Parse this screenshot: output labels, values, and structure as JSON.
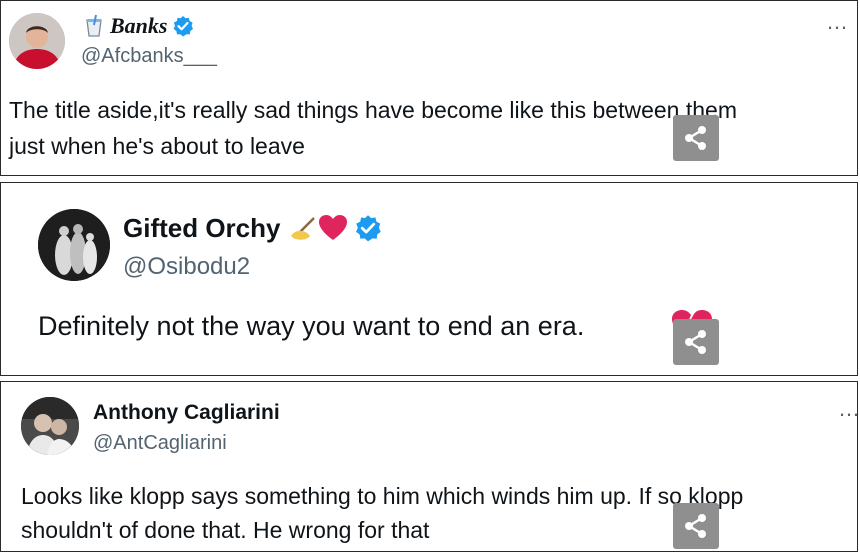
{
  "posts": [
    {
      "name": "Banks",
      "handle": "@Afcbanks___",
      "lines": [
        "The title aside,it's really sad things have become like this between them",
        "just when he's about to leave"
      ],
      "more_label": "…",
      "badge_color": "#1d9bf0"
    },
    {
      "name": "Gifted Orchy",
      "handle": "@Osibodu2",
      "lines": [
        "Definitely not the way you want to end an era."
      ],
      "name_emoji": [
        "pen-icon",
        "heart-icon"
      ],
      "badge_color": "#1d9bf0"
    },
    {
      "name": "Anthony Cagliarini",
      "handle": "@AntCagliarini",
      "lines": [
        "Looks like klopp says something to him which winds him up. If so klopp",
        "shouldn't of done that. He wrong for that"
      ],
      "more_label": "…"
    }
  ],
  "colors": {
    "verified": "#1d9bf0",
    "heart": "#e0245e",
    "handle": "#536471",
    "share_bg": "#8f8f8f"
  }
}
